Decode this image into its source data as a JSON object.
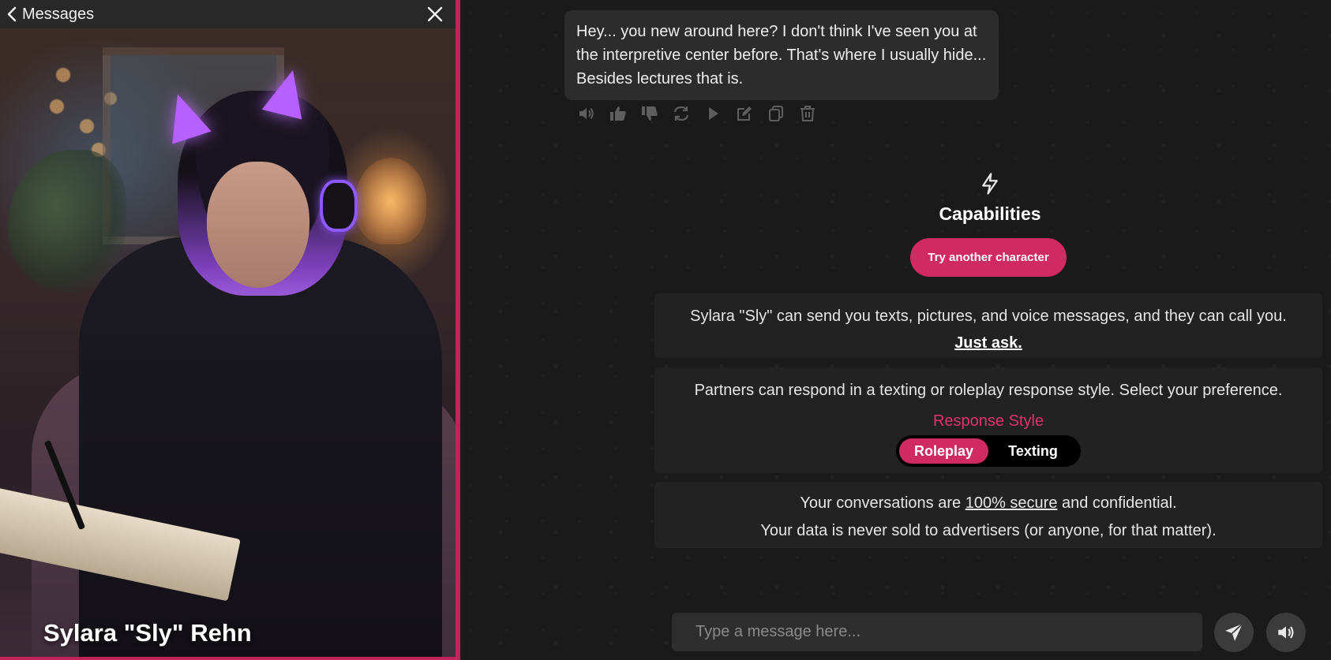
{
  "header": {
    "back_label": "Messages"
  },
  "character": {
    "name": "Sylara \"Sly\" Rehn"
  },
  "chat": {
    "message": "Hey... you new around here? I don't think I've seen you at the interpretive center before. That's where I usually hide... Besides lectures that is.",
    "actions": [
      "speaker-icon",
      "thumbs-up-icon",
      "thumbs-down-icon",
      "regenerate-icon",
      "play-icon",
      "edit-icon",
      "copy-icon",
      "trash-icon"
    ]
  },
  "capabilities": {
    "title": "Capabilities",
    "try_button": "Try another character",
    "info_line": "Sylara \"Sly\" can send you texts, pictures, and voice messages, and they can call you.",
    "just_ask": "Just ask.",
    "style_intro": "Partners can respond in a texting or roleplay response style. Select your preference.",
    "style_label": "Response Style",
    "style_options": [
      "Roleplay",
      "Texting"
    ],
    "selected_style": "Roleplay",
    "privacy_prefix": "Your conversations are ",
    "privacy_link": "100% secure",
    "privacy_suffix": " and confidential.",
    "privacy_line2": "Your data is never sold to advertisers (or anyone, for that matter)."
  },
  "composer": {
    "placeholder": "Type a message here..."
  },
  "colors": {
    "accent": "#d02a62",
    "accent_text": "#e2336d",
    "background": "#1a1a1a",
    "card": "#222222"
  }
}
